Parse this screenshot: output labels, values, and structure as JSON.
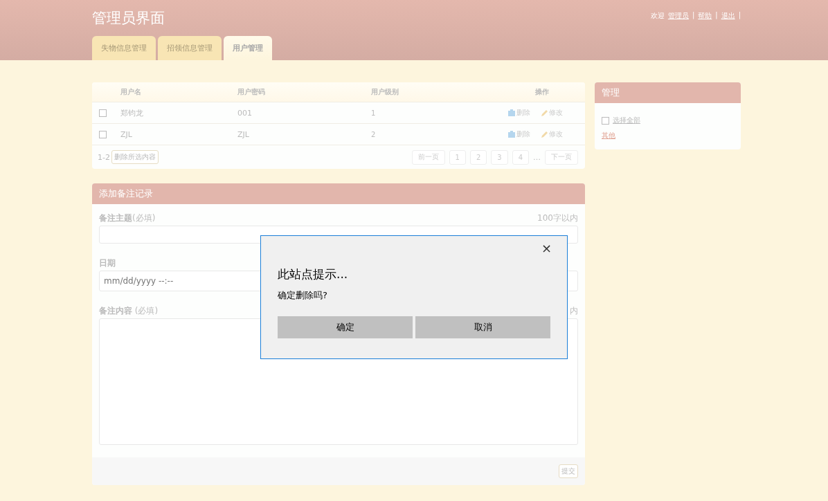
{
  "header": {
    "title": "管理员界面",
    "welcome": "欢迎",
    "links": [
      "管理员",
      "帮助",
      "退出"
    ],
    "separator": "|"
  },
  "tabs": [
    {
      "label": "失物信息管理",
      "selected": false
    },
    {
      "label": "招领信息管理",
      "selected": false
    },
    {
      "label": "用户管理",
      "selected": true
    }
  ],
  "table": {
    "columns": [
      "用户名",
      "用户密码",
      "用户级别",
      "操作"
    ],
    "rows": [
      {
        "checked": false,
        "cells": [
          "郑钧龙",
          "001",
          "1"
        ],
        "actions": [
          "删除",
          "修改"
        ]
      },
      {
        "checked": false,
        "cells": [
          "ZJL",
          "ZJL",
          "2"
        ],
        "actions": [
          "删除",
          "修改"
        ]
      }
    ],
    "range": "1-2",
    "delete_selected": "删除所选内容",
    "pagination": {
      "prev": "前一页",
      "pages": [
        "1",
        "2",
        "3",
        "4"
      ],
      "ellipsis": "…",
      "next": "下一页"
    }
  },
  "sidebar": {
    "title": "管理",
    "select_all": {
      "label": "选择全部",
      "checked": false
    },
    "other": "其他"
  },
  "form": {
    "title": "添加备注记录",
    "fields": [
      {
        "kind": "input",
        "label": "备注主题",
        "hint": "(必填)",
        "counter": "100字以内"
      },
      {
        "kind": "date",
        "label": "日期",
        "placeholder": "mm/dd/yyyy --:--"
      },
      {
        "kind": "textarea",
        "label": "备注内容",
        "hint": " (必填)",
        "counter": "内"
      }
    ],
    "submit": "提交"
  },
  "dialog": {
    "close": "×",
    "title": "此站点提示...",
    "message": "确定删除吗?",
    "buttons": [
      "确定",
      "取消"
    ]
  }
}
